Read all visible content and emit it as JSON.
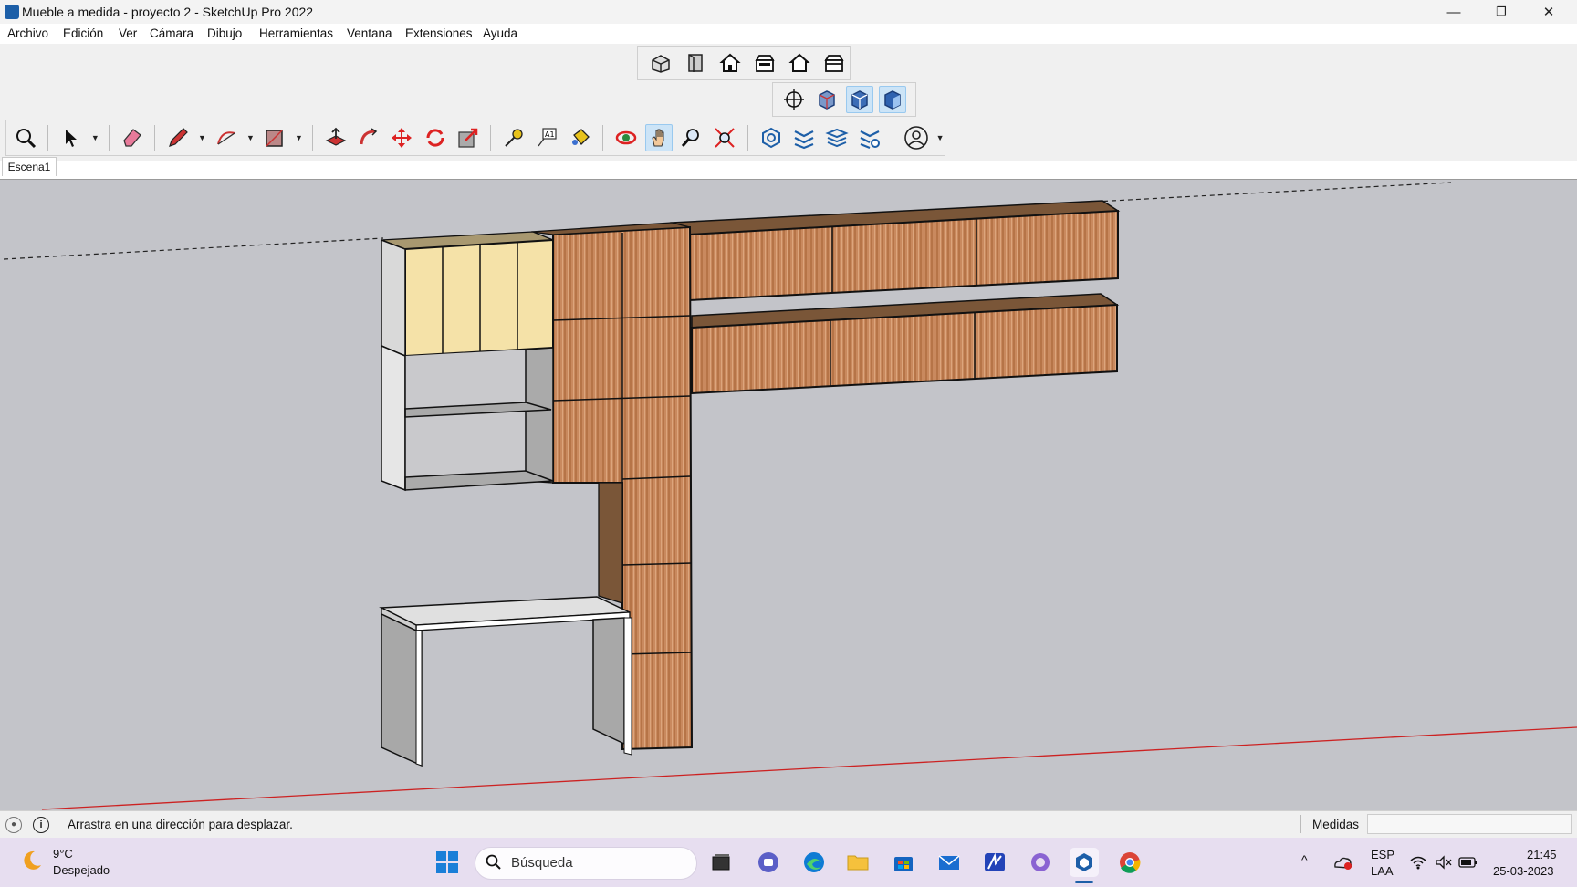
{
  "window": {
    "title": "Mueble a medida - proyecto 2 - SketchUp Pro 2022",
    "minimize": "—",
    "restore": "❐",
    "close": "✕"
  },
  "menu": [
    "Archivo",
    "Edición",
    "Ver",
    "Cámara",
    "Dibujo",
    "Herramientas",
    "Ventana",
    "Extensiones",
    "Ayuda"
  ],
  "views_toolbar": [
    "iso-view-icon",
    "top-view-icon",
    "front-view-icon",
    "right-view-icon",
    "back-view-icon",
    "left-view-icon"
  ],
  "styles_toolbar": [
    "xray-icon",
    "back-edges-icon",
    "wireframe-icon",
    "shaded-icon"
  ],
  "main_toolbar": {
    "active_tool": "pan-icon"
  },
  "scene_tab": "Escena1",
  "statusbar": {
    "message": "Arrastra en una dirección para desplazar.",
    "measure_label": "Medidas",
    "measure_value": ""
  },
  "taskbar": {
    "weather_temp": "9°C",
    "weather_desc": "Despejado",
    "search_placeholder": "Búsqueda",
    "lang": "ESP",
    "layout": "LAA",
    "time": "21:45",
    "date": "25-03-2023"
  },
  "colors": {
    "viewport_bg": "#c3c4c9",
    "wood": "#c9895e",
    "cream_doors": "#f5e2a8",
    "white_panels": "#e6e6e6",
    "gray_panels": "#aaaaaa",
    "axis_red": "#cc2222",
    "accent_blue": "#1d5fa8"
  }
}
